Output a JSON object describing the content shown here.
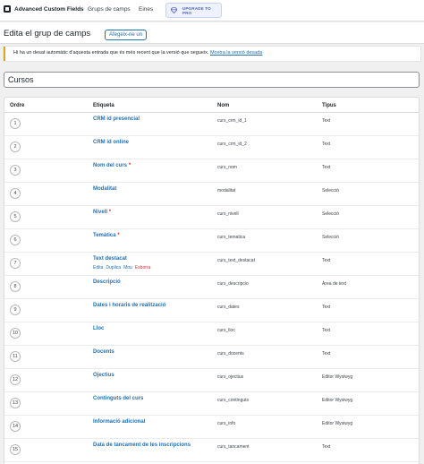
{
  "topbar": {
    "brand": "Advanced Custom Fields",
    "brand_icon": "acf-logo-icon",
    "nav": [
      "Grups de camps",
      "Eines"
    ],
    "upgrade_label": "UPGRADE TO PRO",
    "upgrade_icon": "diamond-icon"
  },
  "header": {
    "title": "Edita el grup de camps",
    "add_new": "Afegeix-ne un"
  },
  "notice": {
    "text": "Hi ha un desat automàtic d'aquesta entrada que és més recent que la versió que segueix.",
    "link": "Mostra la versió desada",
    "accent": "#dba617"
  },
  "group_title": {
    "value": "Cursos"
  },
  "table": {
    "headers": {
      "order": "Ordre",
      "label": "Etiqueta",
      "name": "Nom",
      "type": "Tipus"
    },
    "rows": [
      {
        "order": "1",
        "label": "CRM id presencial",
        "required": "",
        "name": "curs_crm_id_1",
        "type": "Text"
      },
      {
        "order": "2",
        "label": "CRM id online",
        "required": "",
        "name": "curs_crm_id_2",
        "type": "Text"
      },
      {
        "order": "3",
        "label": "Nom del curs",
        "required": "*",
        "name": "curs_nom",
        "type": "Text"
      },
      {
        "order": "4",
        "label": "Modalitat",
        "required": "",
        "name": "modalitat",
        "type": "Selecció"
      },
      {
        "order": "5",
        "label": "Nivell",
        "required": "*",
        "name": "curs_nivell",
        "type": "Selecció"
      },
      {
        "order": "6",
        "label": "Temàtica",
        "required": "*",
        "name": "curs_tematica",
        "type": "Selecció"
      },
      {
        "order": "7",
        "label": "Text destacat",
        "required": "",
        "name": "curs_text_destacat",
        "type": "Text"
      },
      {
        "order": "8",
        "label": "Descripció",
        "required": "",
        "name": "curs_descripcio",
        "type": "Àrea de text"
      },
      {
        "order": "9",
        "label": "Dates i horaris de realització",
        "required": "",
        "name": "curs_dates",
        "type": "Text"
      },
      {
        "order": "10",
        "label": "Lloc",
        "required": "",
        "name": "curs_lloc",
        "type": "Text"
      },
      {
        "order": "11",
        "label": "Docents",
        "required": "",
        "name": "curs_docents",
        "type": "Text"
      },
      {
        "order": "12",
        "label": "Ojectius",
        "required": "",
        "name": "curs_ojectius",
        "type": "Editor Wysiwyg"
      },
      {
        "order": "13",
        "label": "Continguts del curs",
        "required": "",
        "name": "curs_continguts",
        "type": "Editor Wysiwyg"
      },
      {
        "order": "14",
        "label": "Informació adicional",
        "required": "",
        "name": "curs_info",
        "type": "Editor Wysiwyg"
      },
      {
        "order": "15",
        "label": "Data de tancament de les inscripcions",
        "required": "",
        "name": "curs_tancament",
        "type": "Text"
      }
    ],
    "row_actions": {
      "edit": "Edita",
      "duplicate": "Duplica",
      "move": "Mou",
      "delete": "Esborra"
    }
  },
  "colors": {
    "link": "#2271b1",
    "delete": "#d63638",
    "required": "#d63638"
  }
}
